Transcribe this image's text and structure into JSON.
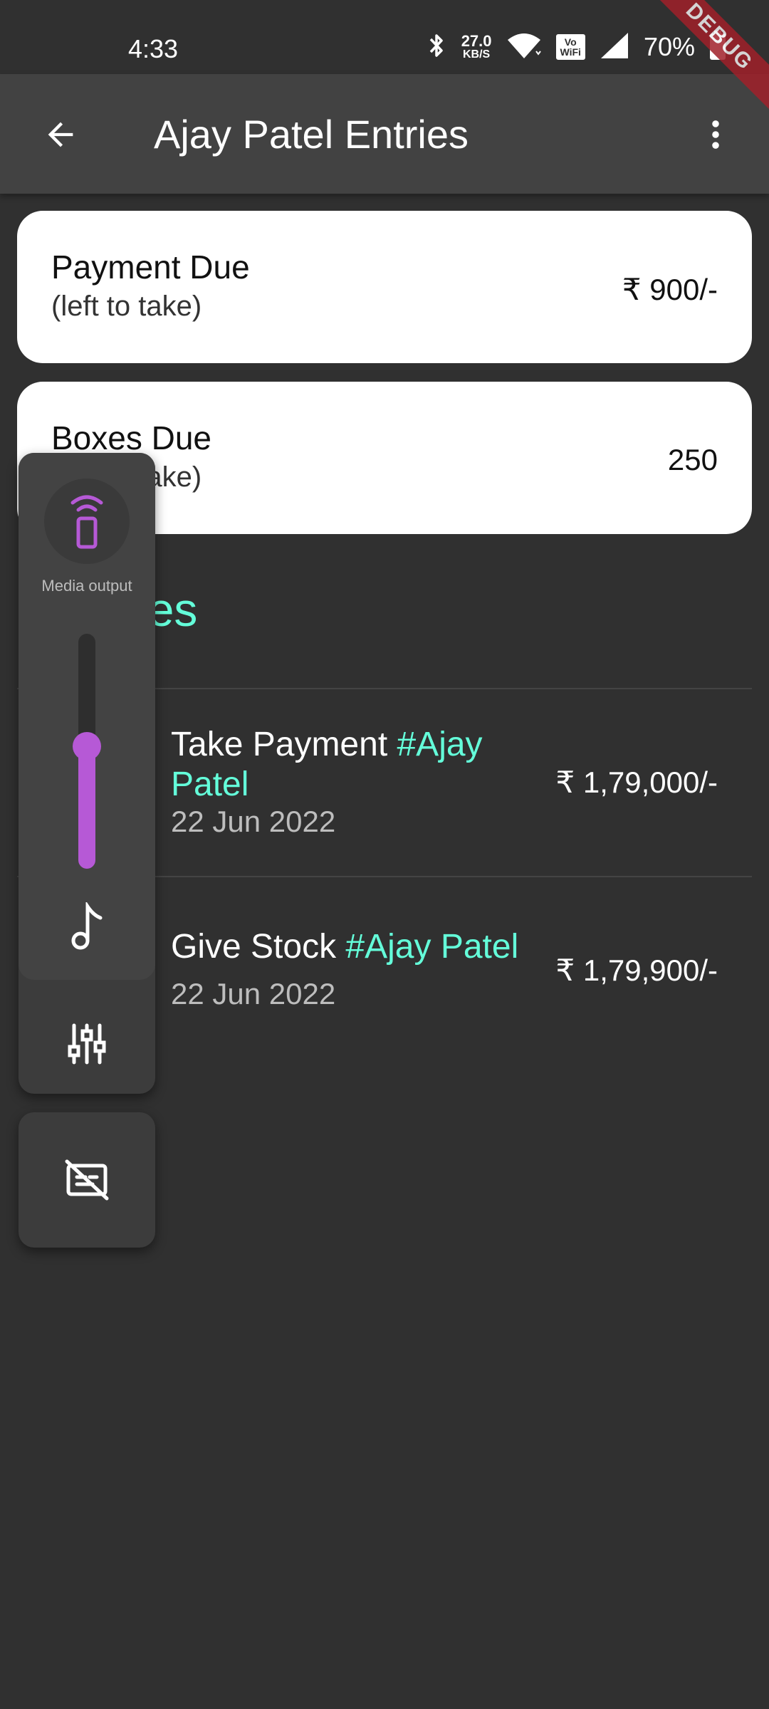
{
  "status_bar": {
    "time": "4:33",
    "net_speed_value": "27.0",
    "net_speed_unit": "KB/S",
    "vowifi_top": "Vo",
    "vowifi_bottom": "WiFi",
    "battery_percent": "70%",
    "icons": [
      "bluetooth-icon",
      "wifi-icon",
      "vowifi-icon",
      "signal-icon",
      "battery-icon"
    ]
  },
  "debug_banner": "DEBUG",
  "app_bar": {
    "title": "Ajay Patel Entries",
    "back_icon": "arrow-back-icon",
    "more_icon": "more-vert-icon"
  },
  "summary": {
    "payment": {
      "title": "Payment Due",
      "subtitle": "(left to take)",
      "value": "₹ 900/-"
    },
    "boxes": {
      "title": "Boxes Due",
      "subtitle": "(left to take)",
      "value": "250"
    }
  },
  "entries_heading": "Entries",
  "entries": [
    {
      "action": "Take Payment ",
      "tag": "#Ajay Patel",
      "date": "22 Jun 2022",
      "amount": "₹ 1,79,000/-"
    },
    {
      "action": "Give Stock ",
      "tag": "#Ajay Patel",
      "date": "22 Jun 2022",
      "amount": "₹ 1,79,900/-"
    }
  ],
  "volume_overlay": {
    "media_output_label": "Media output",
    "volume_level": 0.52,
    "accent_color": "#b659d6",
    "icons": [
      "media-output-icon",
      "music-note-icon",
      "equalizer-icon",
      "captions-off-icon"
    ]
  },
  "colors": {
    "background": "#303030",
    "app_bar": "#424242",
    "accent_teal": "#64ffda",
    "card": "#ffffff"
  }
}
